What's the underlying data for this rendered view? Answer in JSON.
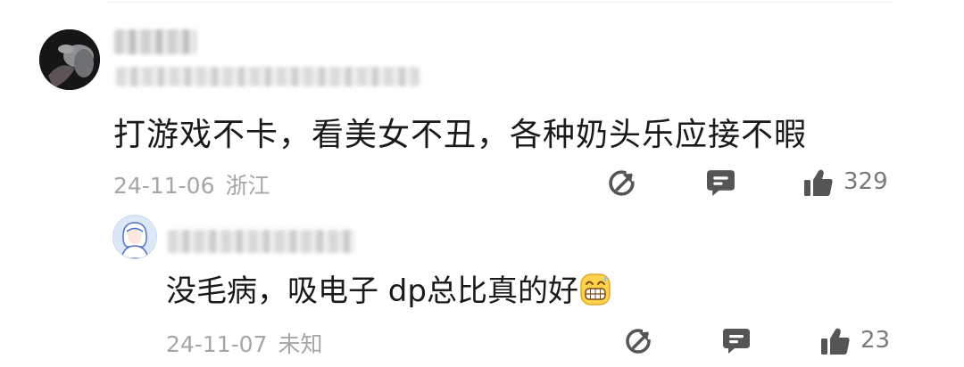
{
  "comment": {
    "text": "打游戏不卡，看美女不丑，各种奶头乐应接不暇",
    "date": "24-11-06",
    "location": "浙江",
    "likes": "329"
  },
  "reply": {
    "text": "没毛病，吸电子 dp总比真的好",
    "emoji": "grin-sweat-emoji",
    "date": "24-11-07",
    "location": "未知",
    "likes": "23"
  },
  "icons": {
    "share": "share-icon",
    "comment": "comment-icon",
    "like": "thumbs-up-icon"
  },
  "colors": {
    "text": "#1a1a1a",
    "meta": "#a6a6a6",
    "icon": "#555555"
  }
}
